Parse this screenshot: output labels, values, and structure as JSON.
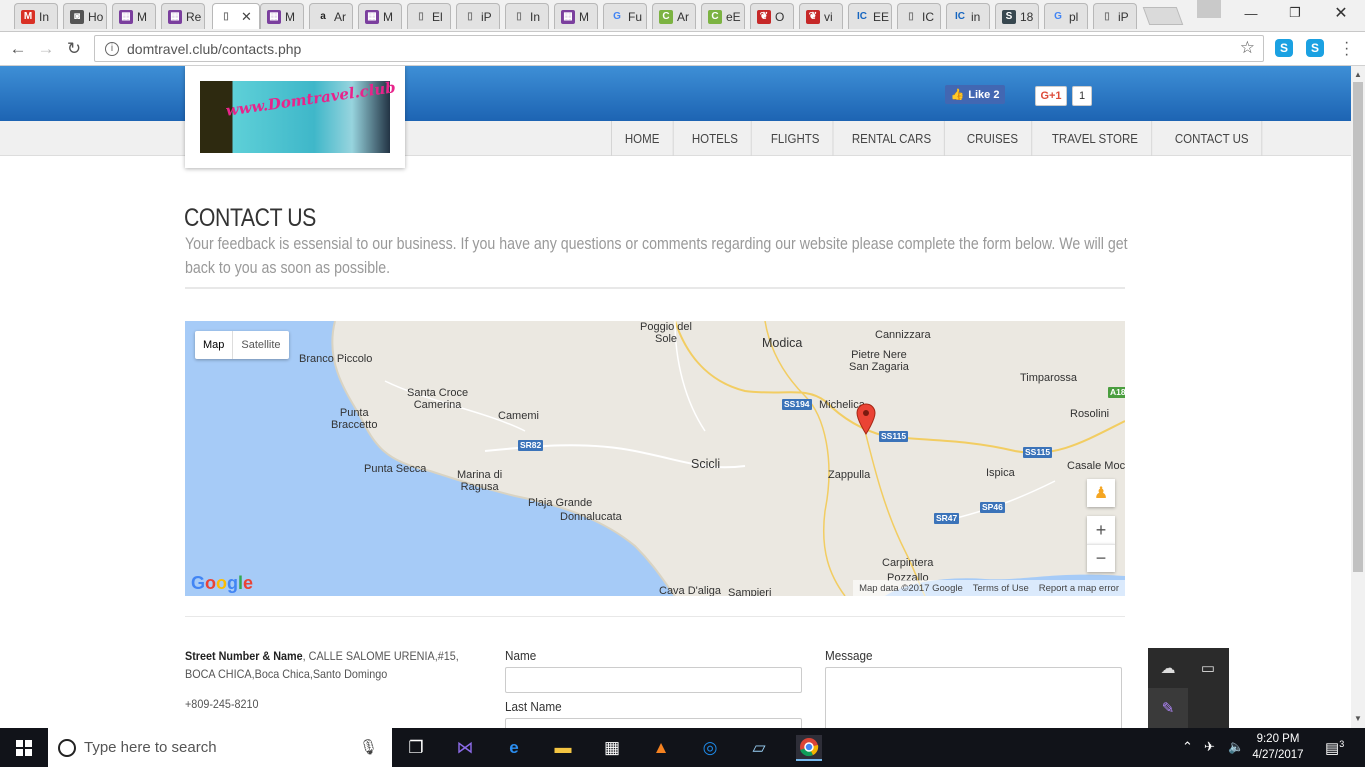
{
  "browser": {
    "tabs": [
      {
        "label": "In",
        "icon": "gmail-icon",
        "color": "#d93025",
        "glyph": "M"
      },
      {
        "label": "Ho",
        "icon": "camera-icon",
        "color": "#555555",
        "glyph": "◙"
      },
      {
        "label": "M",
        "icon": "store-icon",
        "color": "#7b3f9e",
        "glyph": "▦"
      },
      {
        "label": "Re",
        "icon": "store-icon",
        "color": "#7b3f9e",
        "glyph": "▦"
      },
      {
        "label": "",
        "icon": "page-icon",
        "color": "#777777",
        "glyph": "▯",
        "active": true
      },
      {
        "label": "M",
        "icon": "store-icon",
        "color": "#7b3f9e",
        "glyph": "▦"
      },
      {
        "label": "Ar",
        "icon": "amazon-icon",
        "color": "#222222",
        "glyph": "a"
      },
      {
        "label": "M",
        "icon": "store-icon",
        "color": "#7b3f9e",
        "glyph": "▦"
      },
      {
        "label": "El",
        "icon": "page-icon",
        "color": "#777777",
        "glyph": "▯"
      },
      {
        "label": "iP",
        "icon": "page-icon",
        "color": "#777777",
        "glyph": "▯"
      },
      {
        "label": "In",
        "icon": "page-icon",
        "color": "#777777",
        "glyph": "▯"
      },
      {
        "label": "M",
        "icon": "store-icon",
        "color": "#7b3f9e",
        "glyph": "▦"
      },
      {
        "label": "Fu",
        "icon": "google-icon",
        "color": "#4285f4",
        "glyph": "G"
      },
      {
        "label": "Ar",
        "icon": "c-icon",
        "color": "#7cb342",
        "glyph": "C"
      },
      {
        "label": "eE",
        "icon": "c-icon",
        "color": "#7cb342",
        "glyph": "C"
      },
      {
        "label": "O",
        "icon": "pepper-icon",
        "color": "#c62828",
        "glyph": "❦"
      },
      {
        "label": "vi",
        "icon": "pepper-icon",
        "color": "#c62828",
        "glyph": "❦"
      },
      {
        "label": "EE",
        "icon": "ic-icon",
        "color": "#1565c0",
        "glyph": "IC"
      },
      {
        "label": "IC",
        "icon": "page-icon",
        "color": "#777777",
        "glyph": "▯"
      },
      {
        "label": "in",
        "icon": "ic-icon",
        "color": "#1565c0",
        "glyph": "IC"
      },
      {
        "label": "18",
        "icon": "s-icon",
        "color": "#37474f",
        "glyph": "S"
      },
      {
        "label": "pl",
        "icon": "google-icon",
        "color": "#4285f4",
        "glyph": "G"
      },
      {
        "label": "iP",
        "icon": "page-icon",
        "color": "#777777",
        "glyph": "▯"
      }
    ],
    "url": "domtravel.club/contacts.php"
  },
  "site": {
    "logo_text": "www.Domtravel.club",
    "menu": [
      "HOME",
      "HOTELS",
      "FLIGHTS",
      "RENTAL CARS",
      "CRUISES",
      "TRAVEL STORE",
      "CONTACT US"
    ],
    "fb_like": "Like 2",
    "gplus_label": "G+1",
    "gplus_count": "1"
  },
  "content": {
    "title": "CONTACT US",
    "intro": "Your feedback is essensial to our business. If you have any questions or comments regarding our website please complete the form below. We will get back to you as soon as possible."
  },
  "map": {
    "type_map": "Map",
    "type_satellite": "Satellite",
    "labels": [
      "Poggio del Sole",
      "Modica",
      "Cannizzara",
      "Pietre Nere San Zagaria",
      "Branco Piccolo",
      "Timparossa",
      "Santa Croce Camerina",
      "Michelica",
      "Rosolini",
      "Punta Braccetto",
      "Camemi",
      "Scicli",
      "Zappulla",
      "Ispica",
      "Casale Moc",
      "Punta Secca",
      "Marina di Ragusa",
      "Plaja Grande",
      "Donnalucata",
      "Carpintera",
      "Pozzallo",
      "Cava D'aliga",
      "Sampieri"
    ],
    "roads": [
      "SS194",
      "SS115",
      "SS115",
      "SR82",
      "SR47",
      "SP46",
      "A18"
    ],
    "footer": [
      "Map data ©2017 Google",
      "Terms of Use",
      "Report a map error"
    ],
    "google": "Google"
  },
  "contact": {
    "street_label": "Street Number & Name",
    "street_value": ", CALLE SALOME URENIA,#15, BOCA CHICA,Boca Chica,Santo Domingo",
    "phone": "+809-245-8210",
    "name_label": "Name",
    "lastname_label": "Last Name",
    "message_label": "Message"
  },
  "taskbar": {
    "search_placeholder": "Type here to search",
    "time": "9:20 PM",
    "date": "4/27/2017",
    "notifications": "3"
  }
}
